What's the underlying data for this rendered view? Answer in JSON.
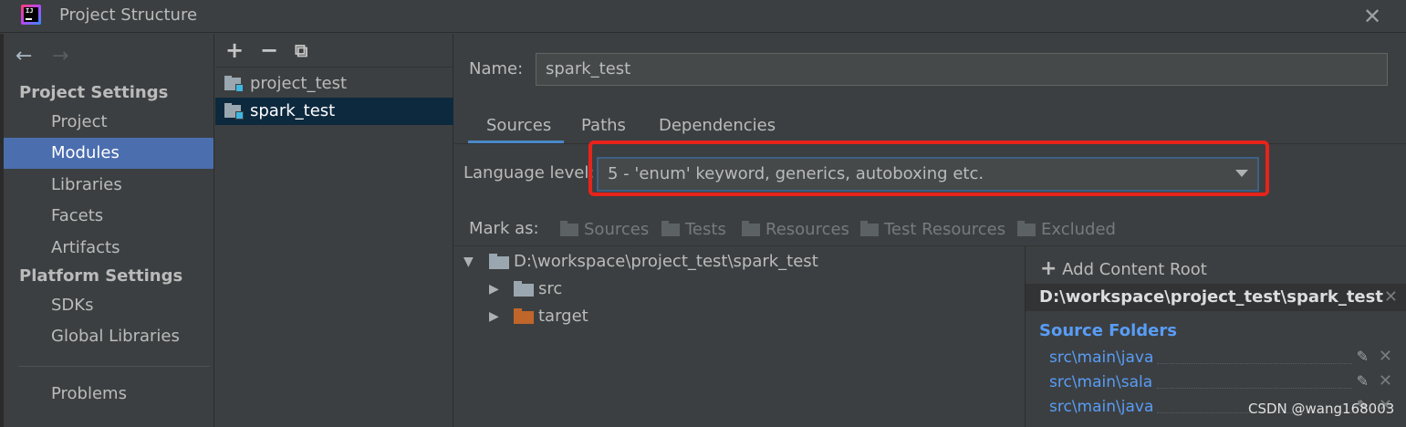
{
  "window": {
    "title": "Project Structure",
    "close_icon": "close-icon"
  },
  "nav": {
    "back": "←",
    "forward": "→",
    "project_settings_heading": "Project Settings",
    "platform_settings_heading": "Platform Settings",
    "items": [
      {
        "label": "Project"
      },
      {
        "label": "Modules"
      },
      {
        "label": "Libraries"
      },
      {
        "label": "Facets"
      },
      {
        "label": "Artifacts"
      },
      {
        "label": "SDKs"
      },
      {
        "label": "Global Libraries"
      },
      {
        "label": "Problems"
      }
    ],
    "selected": "Modules"
  },
  "modules": {
    "toolbar": {
      "add": "+",
      "remove": "−",
      "copy": "⧉"
    },
    "items": [
      {
        "label": "project_test"
      },
      {
        "label": "spark_test"
      }
    ],
    "selected": "spark_test"
  },
  "module": {
    "name_label": "Name:",
    "name_value": "spark_test",
    "tabs": [
      {
        "label": "Sources"
      },
      {
        "label": "Paths"
      },
      {
        "label": "Dependencies"
      }
    ],
    "active_tab": "Sources",
    "language_level_label": "Language level:",
    "language_level_value": "5 - 'enum' keyword, generics, autoboxing etc.",
    "mark_as_label": "Mark as:",
    "mark_as": [
      {
        "label": "Sources"
      },
      {
        "label": "Tests"
      },
      {
        "label": "Resources"
      },
      {
        "label": "Test Resources"
      },
      {
        "label": "Excluded"
      }
    ],
    "tree": {
      "root": "D:\\workspace\\project_test\\spark_test",
      "children": [
        {
          "label": "src"
        },
        {
          "label": "target"
        }
      ]
    },
    "content_roots": {
      "add_label": "Add Content Root",
      "root_path": "D:\\workspace\\project_test\\spark_test",
      "root_close": "✕",
      "source_folders_heading": "Source Folders",
      "source_folders": [
        {
          "path": "src\\main\\java"
        },
        {
          "path": "src\\main\\sala"
        },
        {
          "path": "src\\main\\java"
        }
      ]
    }
  },
  "watermark": "CSDN @wang168003",
  "colors": {
    "accent": "#4b6eaf",
    "selection_dark": "#0d293e",
    "link_blue": "#589df6",
    "highlight_red": "#e8231b"
  }
}
